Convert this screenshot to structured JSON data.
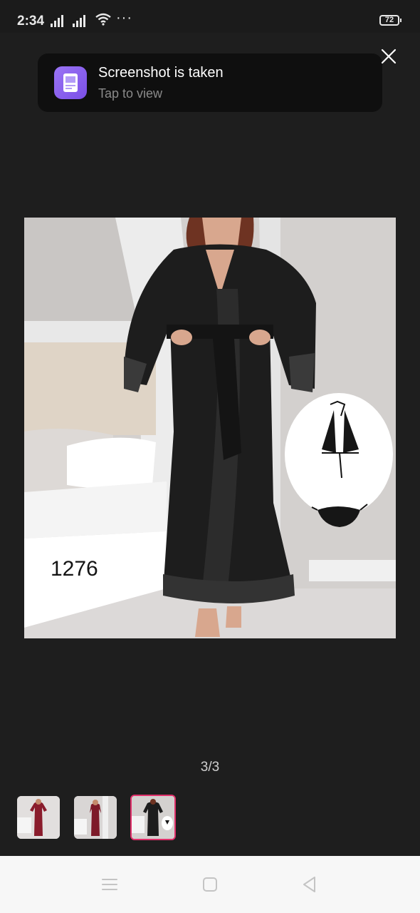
{
  "status_bar": {
    "time": "2:34",
    "battery": "72",
    "extra_indicator": "···",
    "icons": [
      "signal-icon",
      "signal-icon",
      "wifi-icon",
      "battery-icon"
    ]
  },
  "toast": {
    "title": "Screenshot is taken",
    "subtitle": "Tap to view",
    "icon": "gallery-icon",
    "accent": "#8b5cf0"
  },
  "viewer": {
    "close_icon": "close-icon",
    "image_code": "1276",
    "counter": "3/3"
  },
  "thumbnails": [
    {
      "name": "maroon-robe",
      "active": false
    },
    {
      "name": "maroon-robe-2",
      "active": false
    },
    {
      "name": "black-robe",
      "active": true
    }
  ],
  "colors": {
    "background": "#1e1e1e",
    "active_thumb_border": "#e0306a",
    "nav_bar": "#f7f7f7"
  },
  "nav_bar": {
    "buttons": [
      "menu-icon",
      "home-icon",
      "back-icon"
    ]
  }
}
